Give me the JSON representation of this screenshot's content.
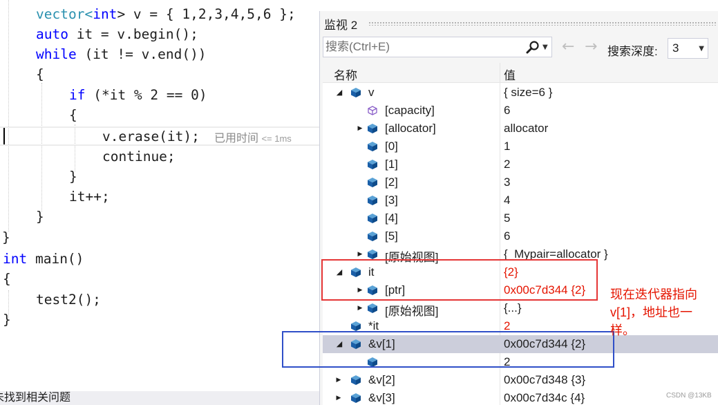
{
  "editor": {
    "code": {
      "l1": {
        "ty": "vector",
        "op": "<",
        "kw": "int",
        "rest": "> v = { 1,2,3,4,5,6 };"
      },
      "l2": {
        "kw": "auto",
        "rest": " it = v.begin();"
      },
      "l3": {
        "kw": "while",
        "rest": " (it != v.end())"
      },
      "l4": "{",
      "l5": {
        "kw": "if",
        "rest": " (*it % 2 == 0)"
      },
      "l6": "{",
      "l7": "v.erase(it);",
      "l8": "continue;",
      "l9": "}",
      "l10": "it++;",
      "l11": "}",
      "l12": "}",
      "l13": {
        "kw": "int",
        "rest": " main()"
      },
      "l14": "{",
      "l15": "test2();",
      "l16": "}"
    },
    "perf_tip": {
      "text": "已用时间 ",
      "value": "<= 1ms"
    },
    "status": "未找到相关问题"
  },
  "watch": {
    "title": "监视 2",
    "search_placeholder": "搜索(Ctrl+E)",
    "depth_label": "搜索深度:",
    "depth_value": "3",
    "col_name": "名称",
    "col_value": "值",
    "rows": [
      {
        "name": "v",
        "value": "{ size=6 }"
      },
      {
        "name": "[capacity]",
        "value": "6"
      },
      {
        "name": "[allocator]",
        "value": "allocator"
      },
      {
        "name": "[0]",
        "value": "1"
      },
      {
        "name": "[1]",
        "value": "2"
      },
      {
        "name": "[2]",
        "value": "3"
      },
      {
        "name": "[3]",
        "value": "4"
      },
      {
        "name": "[4]",
        "value": "5"
      },
      {
        "name": "[5]",
        "value": "6"
      },
      {
        "name": "[原始视图]",
        "value": "{_Mypair=allocator }"
      },
      {
        "name": "it",
        "value": "{2}"
      },
      {
        "name": "[ptr]",
        "value": "0x00c7d344 {2}"
      },
      {
        "name": "[原始视图]",
        "value": "{...}"
      },
      {
        "name": "*it",
        "value": "2"
      },
      {
        "name": "&v[1]",
        "value": "0x00c7d344 {2}"
      },
      {
        "name": "",
        "value": "2"
      },
      {
        "name": "&v[2]",
        "value": "0x00c7d348 {3}"
      },
      {
        "name": "&v[3]",
        "value": "0x00c7d34c {4}"
      }
    ]
  },
  "annotation": "现在迭代器指向v[1]，地址也一样。",
  "watermark": "CSDN @13KB",
  "colors": {
    "keyword": "#0000ff",
    "type": "#2b91af",
    "changed_value": "#e51400",
    "red_box": "#e53535",
    "blue_box": "#2f4fc8",
    "selection": "#cccedb"
  },
  "icons": {
    "member": "blue-cube-icon",
    "capacity": "purple-cube-outline-icon",
    "search": "magnifier-icon"
  }
}
